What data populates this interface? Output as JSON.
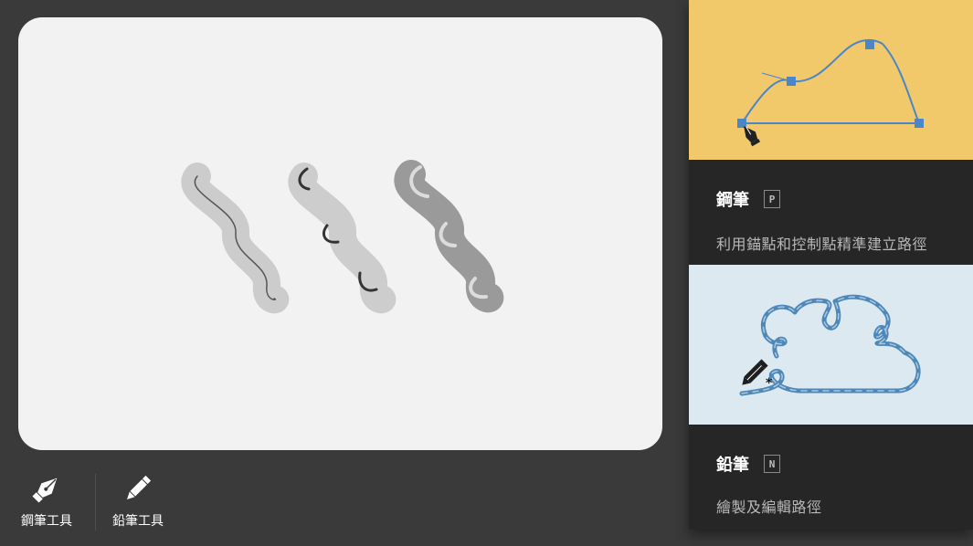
{
  "toolbar": {
    "tools": [
      {
        "label": "鋼筆工具",
        "icon": "pen-nib-icon"
      },
      {
        "label": "鉛筆工具",
        "icon": "pencil-icon"
      }
    ]
  },
  "panel": {
    "cards": [
      {
        "title": "鋼筆",
        "shortcut": "P",
        "description": "利用錨點和控制點精準建立路徑",
        "preview_icon": "pen-nib-icon",
        "preview_bg": "#f1c96b"
      },
      {
        "title": "鉛筆",
        "shortcut": "N",
        "description": "繪製及編輯路徑",
        "preview_icon": "pencil-icon",
        "preview_bg": "#dce9f1"
      }
    ]
  },
  "colors": {
    "app_bg": "#3a3a3a",
    "canvas_bg": "#f2f2f2",
    "panel_bg": "#262626",
    "accent_blue": "#4a86c8",
    "pen_card_bg": "#f1c96b",
    "pencil_card_bg": "#dce9f1"
  }
}
